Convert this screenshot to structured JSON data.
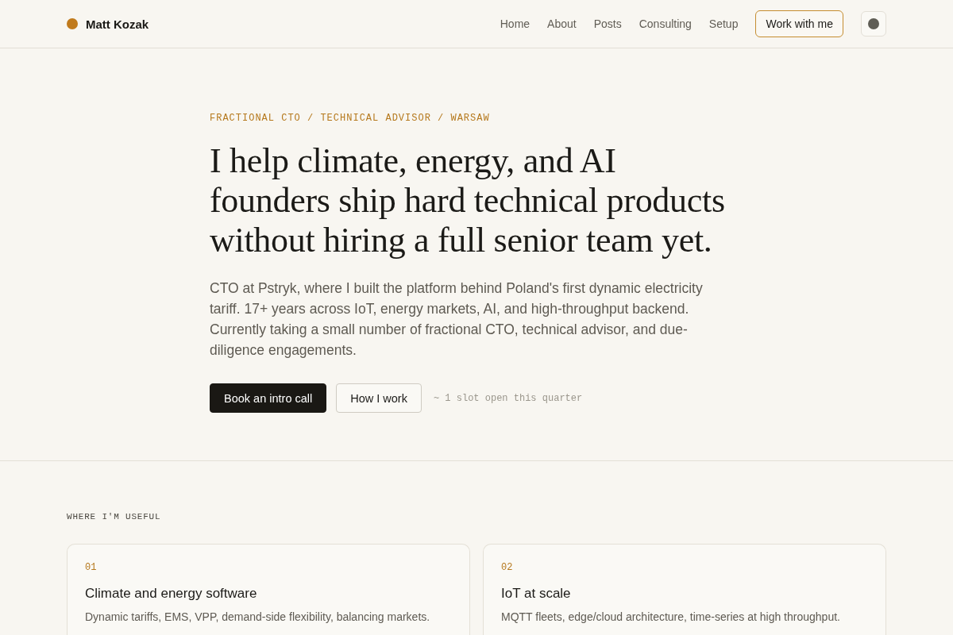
{
  "header": {
    "brand": {
      "name": "Matt Kozak"
    },
    "nav": [
      {
        "label": "Home"
      },
      {
        "label": "About"
      },
      {
        "label": "Posts"
      },
      {
        "label": "Consulting"
      },
      {
        "label": "Setup"
      }
    ],
    "cta": {
      "label": "Work with me"
    }
  },
  "hero": {
    "eyebrow": "FRACTIONAL CTO / TECHNICAL ADVISOR / WARSAW",
    "headline": "I help climate, energy, and AI founders ship hard technical products without hiring a full senior team yet.",
    "intro": "CTO at Pstryk, where I built the platform behind Poland's first dynamic electricity tariff. 17+ years across IoT, energy markets, AI, and high-throughput backend. Currently taking a small number of fractional CTO, technical advisor, and due-diligence engagements.",
    "buttons": [
      {
        "label": "Book an intro call",
        "kind": "primary"
      },
      {
        "label": "How I work",
        "kind": "secondary"
      }
    ],
    "note": "~ 1 slot open this quarter"
  },
  "useful": {
    "heading": "WHERE I'M USEFUL",
    "cards": [
      {
        "number": "01",
        "title": "Climate and energy software",
        "description": "Dynamic tariffs, EMS, VPP, demand-side flexibility, balancing markets."
      },
      {
        "number": "02",
        "title": "IoT at scale",
        "description": "MQTT fleets, edge/cloud architecture, time-series at high throughput."
      }
    ]
  }
}
